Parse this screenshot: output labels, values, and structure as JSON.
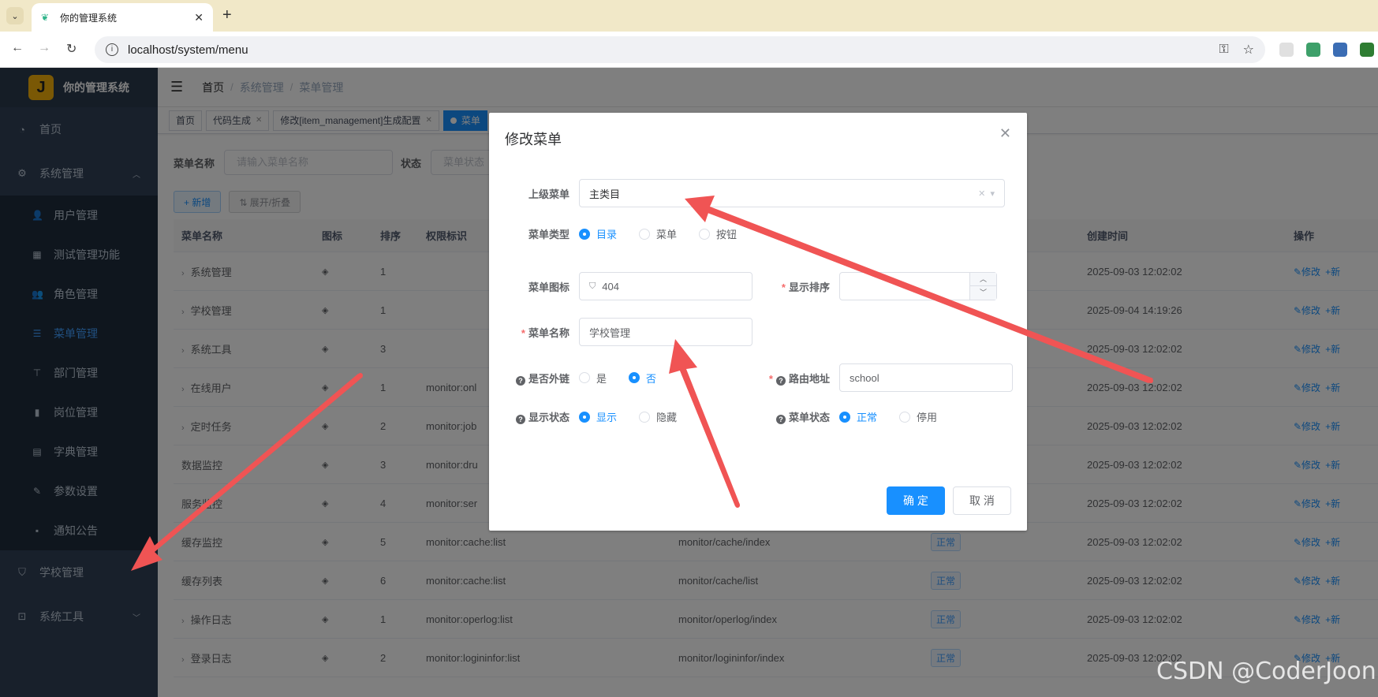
{
  "browser": {
    "tab_title": "你的管理系统",
    "url": "localhost/system/menu"
  },
  "app": {
    "logo_letter": "J",
    "name": "你的管理系统"
  },
  "sidebar": {
    "items": [
      {
        "label": "首页",
        "icon": "dashboard-icon"
      },
      {
        "label": "系统管理",
        "icon": "gear-icon"
      },
      {
        "label": "学校管理",
        "icon": "school-icon"
      },
      {
        "label": "系统工具",
        "icon": "toolbox-icon"
      }
    ],
    "sub_items": [
      {
        "label": "用户管理",
        "icon": "user-icon"
      },
      {
        "label": "测试管理功能",
        "icon": "table-icon"
      },
      {
        "label": "角色管理",
        "icon": "peoples-icon"
      },
      {
        "label": "菜单管理",
        "icon": "tree-table-icon"
      },
      {
        "label": "部门管理",
        "icon": "tree-icon"
      },
      {
        "label": "岗位管理",
        "icon": "post-icon"
      },
      {
        "label": "字典管理",
        "icon": "dict-icon"
      },
      {
        "label": "参数设置",
        "icon": "edit-icon"
      },
      {
        "label": "通知公告",
        "icon": "message-icon"
      }
    ]
  },
  "breadcrumb": [
    "首页",
    "系统管理",
    "菜单管理"
  ],
  "tags": [
    {
      "label": "首页"
    },
    {
      "label": "代码生成"
    },
    {
      "label": "修改[item_management]生成配置"
    },
    {
      "label": "菜单"
    }
  ],
  "search": {
    "name_label": "菜单名称",
    "name_placeholder": "请输入菜单名称",
    "status_label": "状态",
    "status_placeholder": "菜单状态"
  },
  "actions": {
    "add": "+ 新增",
    "expand": "⇅ 展开/折叠"
  },
  "table": {
    "headers": [
      "菜单名称",
      "图标",
      "排序",
      "权限标识",
      "",
      "",
      "创建时间",
      "操作"
    ],
    "rows": [
      {
        "name": "系统管理",
        "expand": true,
        "sort": "1",
        "perm": "",
        "comp": "",
        "status": "",
        "time": "2025-09-03 12:02:02",
        "icon": "gear"
      },
      {
        "name": "学校管理",
        "expand": true,
        "sort": "1",
        "perm": "",
        "comp": "",
        "status": "",
        "time": "2025-09-04 14:19:26",
        "icon": "404"
      },
      {
        "name": "系统工具",
        "expand": true,
        "sort": "3",
        "perm": "",
        "comp": "",
        "status": "",
        "time": "2025-09-03 12:02:02",
        "icon": "tool"
      },
      {
        "name": "在线用户",
        "expand": true,
        "sort": "1",
        "perm": "monitor:onl",
        "comp": "",
        "status": "",
        "time": "2025-09-03 12:02:02",
        "icon": "online"
      },
      {
        "name": "定时任务",
        "expand": true,
        "sort": "2",
        "perm": "monitor:job",
        "comp": "",
        "status": "",
        "time": "2025-09-03 12:02:02",
        "icon": "job"
      },
      {
        "name": "数据监控",
        "expand": false,
        "sort": "3",
        "perm": "monitor:dru",
        "comp": "",
        "status": "",
        "time": "2025-09-03 12:02:02",
        "icon": "druid"
      },
      {
        "name": "服务监控",
        "expand": false,
        "sort": "4",
        "perm": "monitor:ser",
        "comp": "",
        "status": "",
        "time": "2025-09-03 12:02:02",
        "icon": "server"
      },
      {
        "name": "缓存监控",
        "expand": false,
        "sort": "5",
        "perm": "monitor:cache:list",
        "comp": "monitor/cache/index",
        "status": "正常",
        "time": "2025-09-03 12:02:02",
        "icon": "redis"
      },
      {
        "name": "缓存列表",
        "expand": false,
        "sort": "6",
        "perm": "monitor:cache:list",
        "comp": "monitor/cache/list",
        "status": "正常",
        "time": "2025-09-03 12:02:02",
        "icon": "redis-list"
      },
      {
        "name": "操作日志",
        "expand": true,
        "sort": "1",
        "perm": "monitor:operlog:list",
        "comp": "monitor/operlog/index",
        "status": "正常",
        "time": "2025-09-03 12:02:02",
        "icon": "form"
      },
      {
        "name": "登录日志",
        "expand": true,
        "sort": "2",
        "perm": "monitor:logininfor:list",
        "comp": "monitor/logininfor/index",
        "status": "正常",
        "time": "2025-09-03 12:02:02",
        "icon": "logininfor"
      }
    ],
    "op_edit": "✎修改",
    "op_add": "+新"
  },
  "dialog": {
    "title": "修改菜单",
    "parent_label": "上级菜单",
    "parent_value": "主类目",
    "type_label": "菜单类型",
    "type_options": [
      "目录",
      "菜单",
      "按钮"
    ],
    "type_selected": 0,
    "icon_label": "菜单图标",
    "icon_value": "404",
    "sort_label": "显示排序",
    "sort_value": "",
    "name_label": "菜单名称",
    "name_value": "学校管理",
    "external_label": "是否外链",
    "external_options": [
      "是",
      "否"
    ],
    "external_selected": 1,
    "path_label": "路由地址",
    "path_value": "school",
    "visible_label": "显示状态",
    "visible_options": [
      "显示",
      "隐藏"
    ],
    "visible_selected": 0,
    "status_label": "菜单状态",
    "status_options": [
      "正常",
      "停用"
    ],
    "status_selected": 0,
    "ok": "确 定",
    "cancel": "取 消"
  },
  "colors": {
    "sidebar_bg": "#304156",
    "primary": "#1890ff",
    "arrow": "#f05454"
  },
  "watermark": "CSDN @CoderJoon"
}
